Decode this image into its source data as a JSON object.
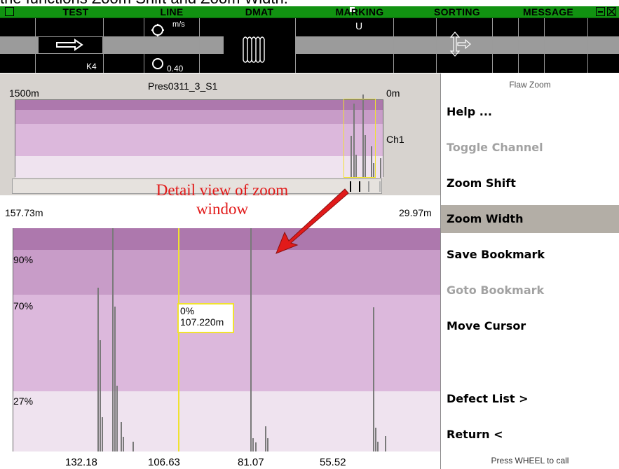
{
  "caption": "the functions Zoom Shift and Zoom Width.",
  "menubar": {
    "items": [
      "TEST",
      "LINE",
      "DMAT",
      "MARKING",
      "SORTING",
      "MESSAGE"
    ],
    "print_icon": "printer-icon",
    "window_icons": [
      "minimize-icon",
      "close-icon"
    ]
  },
  "status": {
    "speed_unit": "m/s",
    "marking_value": "U",
    "sensor_label": "K4",
    "gauge_value": "0.40",
    "icons": [
      "direction-arrow-icon",
      "circle-indicator-icon",
      "coil-icon",
      "sort-arrows-icon"
    ]
  },
  "overview": {
    "left_label": "1500m",
    "title": "Pres0311_3_S1",
    "right_label": "0m",
    "channel": "Ch1"
  },
  "detail": {
    "left_label": "157.73m",
    "right_label": "29.97m",
    "levels": [
      "90%",
      "70%",
      "27%"
    ],
    "cursor_percent": "0%",
    "cursor_position": "107.220m",
    "x_ticks": [
      "132.18",
      "106.63",
      "81.07",
      "55.52"
    ]
  },
  "annotation": "Detail view of zoom window",
  "menu": {
    "title": "Flaw Zoom",
    "items": [
      {
        "label": "Help ...",
        "state": "enabled"
      },
      {
        "label": "Toggle Channel",
        "state": "disabled"
      },
      {
        "label": "Zoom Shift",
        "state": "enabled"
      },
      {
        "label": "Zoom Width",
        "state": "selected"
      },
      {
        "label": "Save Bookmark",
        "state": "enabled"
      },
      {
        "label": "Goto Bookmark",
        "state": "disabled"
      },
      {
        "label": "Move Cursor",
        "state": "enabled"
      },
      {
        "label": "Defect List >",
        "state": "enabled"
      },
      {
        "label": "Return <",
        "state": "enabled"
      }
    ],
    "footer": "Press WHEEL to call"
  },
  "colors": {
    "menubar_bg": "#119211",
    "band_dark": "#ad78ad",
    "band_mid": "#c89cc8",
    "band_light": "#dcb8dc",
    "band_pale": "#efe3ef",
    "zoom_window": "#f0e230",
    "annotation": "#e11a1a",
    "selected_item": "#b3aea6"
  }
}
